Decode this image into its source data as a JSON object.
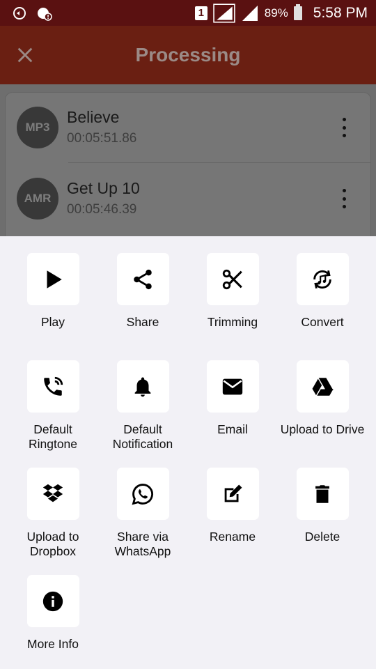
{
  "status_bar": {
    "sim_slot": "1",
    "battery_percent": "89%",
    "time": "5:58 PM"
  },
  "app_bar": {
    "title": "Processing"
  },
  "files": [
    {
      "badge": "MP3",
      "name": "Believe",
      "duration": "00:05:51.86"
    },
    {
      "badge": "AMR",
      "name": "Get Up 10",
      "duration": "00:05:46.39"
    }
  ],
  "actions": [
    {
      "label": "Play",
      "icon": "play-icon"
    },
    {
      "label": "Share",
      "icon": "share-icon"
    },
    {
      "label": "Trimming",
      "icon": "scissors-icon"
    },
    {
      "label": "Convert",
      "icon": "convert-music-icon"
    },
    {
      "label": "Default\nRingtone",
      "icon": "phone-ringing-icon"
    },
    {
      "label": "Default\nNotification",
      "icon": "bell-icon"
    },
    {
      "label": "Email",
      "icon": "envelope-icon"
    },
    {
      "label": "Upload to Drive",
      "icon": "google-drive-icon"
    },
    {
      "label": "Upload to\nDropbox",
      "icon": "dropbox-icon"
    },
    {
      "label": "Share via\nWhatsApp",
      "icon": "whatsapp-icon"
    },
    {
      "label": "Rename",
      "icon": "edit-icon"
    },
    {
      "label": "Delete",
      "icon": "trash-icon"
    },
    {
      "label": "More Info",
      "icon": "info-icon"
    }
  ]
}
